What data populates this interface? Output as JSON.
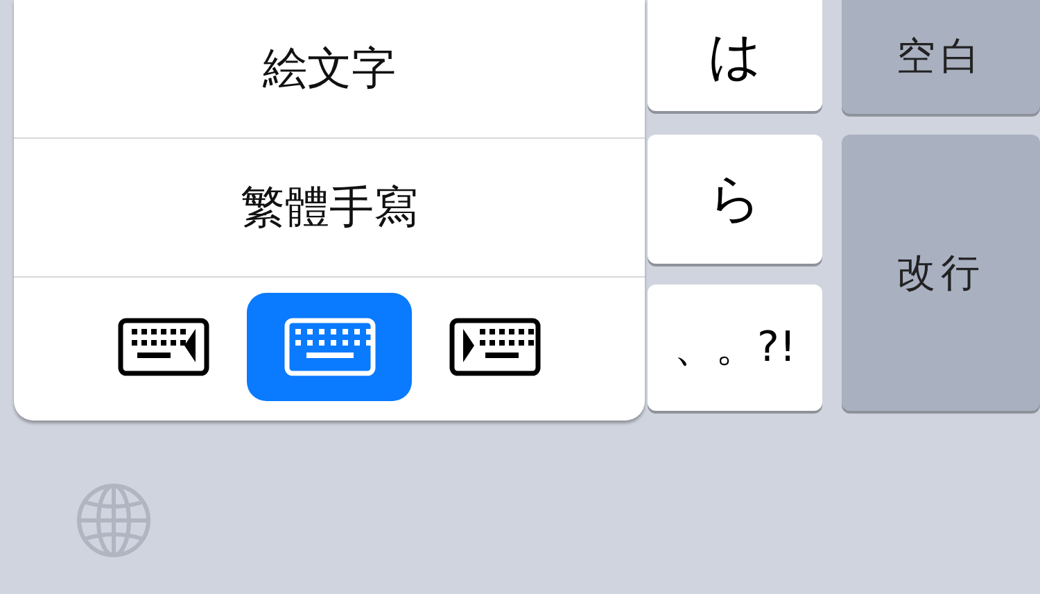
{
  "popup": {
    "items": [
      {
        "label": "絵文字"
      },
      {
        "label": "繁體手寫"
      }
    ],
    "modes": [
      {
        "kind": "left",
        "selected": false
      },
      {
        "kind": "full",
        "selected": true
      },
      {
        "kind": "right",
        "selected": false
      }
    ]
  },
  "keys": [
    {
      "label": "は"
    },
    {
      "label": "ら"
    },
    {
      "label": "、。?!"
    }
  ],
  "action_keys": [
    {
      "label": "空白",
      "kind": "small"
    },
    {
      "label": "改行",
      "kind": "tall"
    }
  ]
}
